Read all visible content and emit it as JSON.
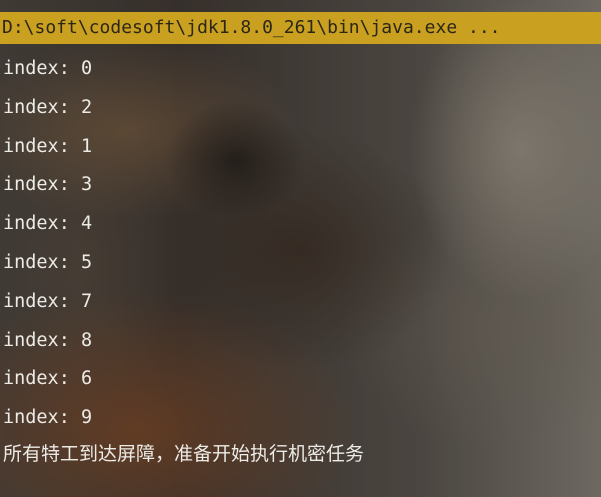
{
  "console": {
    "command_line": "D:\\soft\\codesoft\\jdk1.8.0_261\\bin\\java.exe ...",
    "output_lines": [
      "index: 0",
      "index: 2",
      "index: 1",
      "index: 3",
      "index: 4",
      "index: 5",
      "index: 7",
      "index: 8",
      "index: 6",
      "index: 9"
    ],
    "final_message": "所有特工到达屏障，准备开始执行机密任务"
  },
  "colors": {
    "highlight_bar": "#c9a020",
    "output_text": "#ecebe6"
  }
}
